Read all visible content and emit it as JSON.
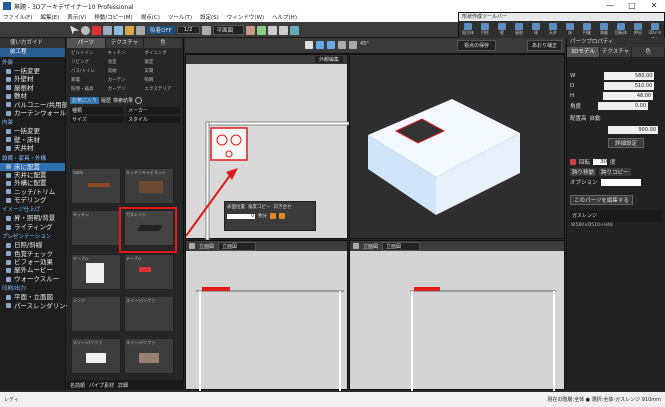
{
  "window": {
    "title": "無題 - 3Dアーキデザイナー10 Professional",
    "minimize": "—",
    "maximize": "□",
    "close": "✕"
  },
  "menu": [
    "ファイル(F)",
    "編集(E)",
    "表示(V)",
    "移動/コピー(M)",
    "視点(C)",
    "ツール(T)",
    "設定(S)",
    "ウィンドウ(W)",
    "ヘルプ(H)"
  ],
  "toolbar": {
    "snap": "吸着OFF",
    "scale": "1/2",
    "view_select": "平面図",
    "floor_label": "1階"
  },
  "floating_toolbar": {
    "title": "形状作成ツールバー",
    "tools": [
      "直方体",
      "円柱",
      "壁",
      "屋根",
      "球",
      "天井",
      "床",
      "円錐",
      "角錐",
      "回転体",
      "押出",
      "3Dテキスト",
      "ループ"
    ]
  },
  "left_panel": {
    "header": "使い方ガイド",
    "tab": "前工程",
    "sections": [
      {
        "title": "外装",
        "items": [
          "一括変更",
          "外壁材",
          "屋根材",
          "敷材",
          "バルコニー/共用部下",
          "カーテンウォール"
        ]
      },
      {
        "title": "内装",
        "items": [
          "一括変更",
          "壁・床材",
          "天井材"
        ]
      },
      {
        "title": "設備・家具・外構",
        "items": [
          "床に配置",
          "天井に配置",
          "外構に配置",
          "ニッチ/トリム",
          "モデリング"
        ]
      },
      {
        "title": "イメージ仕上げ",
        "items": [
          "昇・照明/背景",
          "ライティング"
        ]
      },
      {
        "title": "プレゼンテーション",
        "items": [
          "日照/斜線",
          "色覚チェック",
          "ビフォー効果",
          "屋外ムービー",
          "ウォークスルー"
        ]
      },
      {
        "title": "印刷/出力",
        "items": [
          "平面・立面図",
          "パースレンダリング"
        ]
      }
    ],
    "selected": "床に配置"
  },
  "catalog": {
    "tabs": [
      "パーツ",
      "テクスチャ",
      "色"
    ],
    "categories": [
      "ビルトイン",
      "キッチン",
      "ダイニング",
      "リビング",
      "浴室",
      "寝室",
      "バス/トイレ",
      "収納",
      "玄関",
      "家電",
      "カーテン",
      "照明",
      "照明・器具",
      "ガーデン",
      "エクステリア"
    ],
    "filters": {
      "favorites": "お気に入り",
      "history": "履歴",
      "search_result": "検索結果",
      "type": "種類",
      "maker": "メーカー",
      "size": "サイズ",
      "style": "スタイル"
    },
    "items": [
      "table",
      "キッチンキャビネット",
      "ガスレンジ",
      "キッチン",
      "テーブル",
      "テーブル",
      "シンク",
      "スイーツ/ソファ",
      "スイーツ/ソファ",
      "スイーツ/ソファ"
    ],
    "footer": {
      "sort": "名前順",
      "show_only_attr": "パイプ素材",
      "details": "詳細"
    }
  },
  "views": {
    "top": {
      "mode": "外観編集",
      "angle": "45°",
      "dialog_values": {
        "opt1": "表面位置",
        "opt2": "角度コピー",
        "opt3": "向き合せ",
        "count": "0",
        "unit": "枚分"
      }
    },
    "view3d": {
      "label": "視点の保存",
      "mode": "あおり補正"
    },
    "front1": {
      "label": "立面図",
      "select": "立面図"
    },
    "front2": {
      "label": "立面図",
      "select": "立面図"
    }
  },
  "properties": {
    "title": "パーツプロパティ",
    "tabs": [
      "3Dモデル",
      "テクスチャ",
      "色"
    ],
    "w": "580.00",
    "d": "510.00",
    "h": "48.00",
    "angle_label": "角度",
    "angle": "0.00",
    "place_label": "配置高",
    "auto": "自動",
    "place_value": "900.00",
    "detail_button": "詳細設定",
    "rotation_label": "回転",
    "rotation": "30",
    "rotation_unit": "度",
    "toggles": [
      "跨り移動",
      "跨りコピー"
    ],
    "option_label": "オプション",
    "edit_button": "このパーツを編集する",
    "part_name": "ガスレンジ",
    "part_desc": "W580×D510×H48"
  },
  "statusbar": {
    "left": "レディ",
    "right": "現在の階層:全体  ● 選択:全体-ガスレンジ  910mm"
  }
}
